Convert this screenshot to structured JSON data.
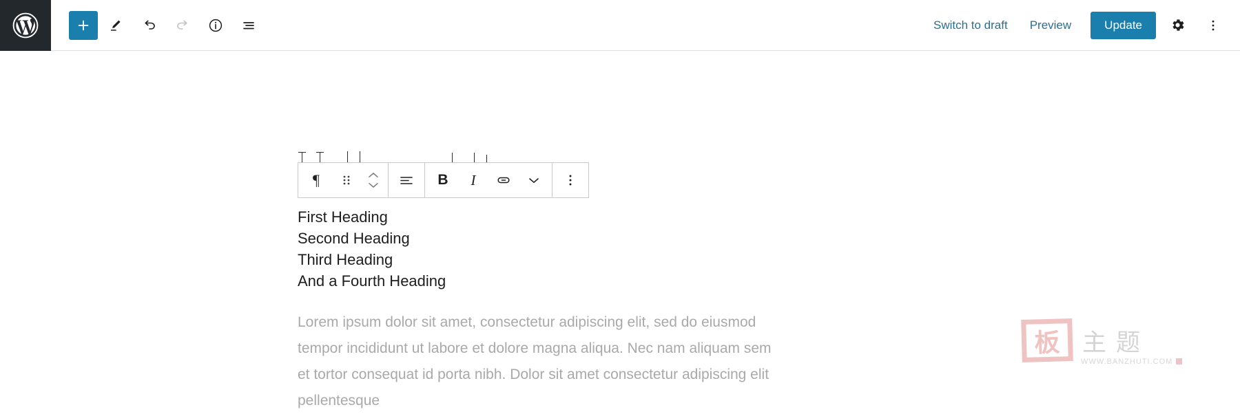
{
  "header": {
    "logo_icon": "wordpress-logo-icon",
    "left_tools": [
      {
        "name": "add-block-button",
        "icon": "plus-icon",
        "label": "Add block",
        "primary": true
      },
      {
        "name": "edit-tool-button",
        "icon": "pencil-icon",
        "label": "Edit"
      },
      {
        "name": "undo-button",
        "icon": "undo-arrow-icon",
        "label": "Undo"
      },
      {
        "name": "redo-button",
        "icon": "redo-arrow-icon",
        "label": "Redo",
        "disabled": true
      },
      {
        "name": "details-button",
        "icon": "info-circle-icon",
        "label": "Details"
      },
      {
        "name": "list-view-button",
        "icon": "list-view-icon",
        "label": "List view"
      }
    ],
    "switch_to_draft_label": "Switch to draft",
    "preview_label": "Preview",
    "update_label": "Update",
    "settings_icon": "gear-icon",
    "options_icon": "three-dots-vertical-icon",
    "accent_color": "#1a7fad",
    "link_color": "#2a6f8e",
    "logo_background": "#23282d"
  },
  "block_toolbar": {
    "groups": [
      {
        "name": "block-type-group",
        "buttons": [
          {
            "name": "block-type-paragraph-button",
            "icon": "pilcrow-icon",
            "glyph": "¶",
            "label": "Paragraph"
          },
          {
            "name": "drag-handle-button",
            "icon": "drag-dots-icon",
            "label": "Drag"
          },
          {
            "name": "move-block-button",
            "icon": "move-up-down-chevrons-icon",
            "label": "Move up / Move down"
          }
        ]
      },
      {
        "name": "alignment-group",
        "buttons": [
          {
            "name": "align-text-button",
            "icon": "align-left-icon",
            "label": "Align text"
          }
        ]
      },
      {
        "name": "formatting-group",
        "buttons": [
          {
            "name": "bold-button",
            "icon": "bold-icon",
            "glyph": "B",
            "label": "Bold"
          },
          {
            "name": "italic-button",
            "icon": "italic-icon",
            "glyph": "I",
            "label": "Italic"
          },
          {
            "name": "link-button",
            "icon": "link-icon",
            "label": "Link"
          },
          {
            "name": "more-rich-text-button",
            "icon": "chevron-down-icon",
            "label": "More"
          }
        ]
      },
      {
        "name": "block-options-group",
        "buttons": [
          {
            "name": "block-options-button",
            "icon": "three-dots-vertical-icon",
            "label": "Options"
          }
        ]
      }
    ]
  },
  "content": {
    "headings": [
      "First Heading",
      "Second Heading",
      "Third Heading",
      "And a Fourth Heading"
    ],
    "paragraph": "Lorem ipsum dolor sit amet, consectetur adipiscing elit, sed do eiusmod tempor incididunt ut labore et dolore magna aliqua. Nec nam aliquam sem et tortor consequat id porta nibh. Dolor sit amet consectetur adipiscing elit pellentesque"
  },
  "watermark": {
    "stamp_text": "板",
    "cn_text": "主题",
    "url": "WWW.BANZHUTI.COM",
    "color": "#d8736f"
  }
}
